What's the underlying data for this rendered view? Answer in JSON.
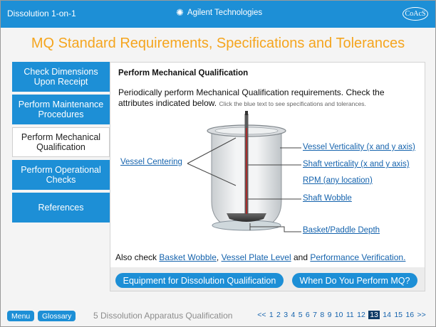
{
  "header": {
    "app_title": "Dissolution 1-on-1",
    "brand_name": "Agilent Technologies",
    "badge_text": "CoAcS"
  },
  "headline": "MQ Standard Requirements, Specifications and Tolerances",
  "nav": {
    "items": [
      {
        "label": "Check Dimensions Upon Receipt"
      },
      {
        "label": "Perform Maintenance Procedures"
      },
      {
        "label": "Perform Mechanical Qualification"
      },
      {
        "label": "Perform Operational Checks"
      },
      {
        "label": "References"
      }
    ],
    "active_index": 2
  },
  "content": {
    "title": "Perform Mechanical Qualification",
    "intro": "Periodically perform Mechanical Qualification requirements. Check the attributes indicated below.",
    "hint": "Click the blue text to see specifications and tolerances.",
    "diagram_links": {
      "vessel_centering": "Vessel Centering",
      "vessel_verticality": "Vessel Verticality (x and y axis)",
      "shaft_verticality": "Shaft verticality (x and y axis)",
      "rpm": "RPM (any location)",
      "shaft_wobble": "Shaft Wobble",
      "basket_paddle_depth": "Basket/Paddle Depth"
    },
    "also_check": {
      "prefix": "Also check",
      "link1": "Basket Wobble",
      "sep1": ",",
      "link2": "Vessel Plate Level",
      "and_word": "and",
      "link3": "Performance Verification."
    },
    "buttons": {
      "equipment": "Equipment for Dissolution Qualification",
      "when": "When Do You Perform MQ?"
    }
  },
  "footer": {
    "menu_label": "Menu",
    "glossary_label": "Glossary",
    "section_label": "5 Dissolution Apparatus Qualification",
    "pager_prev": "<<",
    "pages": [
      "1",
      "2",
      "3",
      "4",
      "5",
      "6",
      "7",
      "8",
      "9",
      "10",
      "11",
      "12",
      "13",
      "14",
      "15",
      "16"
    ],
    "current_page": "13",
    "pager_next": ">>"
  },
  "colors": {
    "accent_blue": "#1d8fd6",
    "headline_orange": "#f5a51e",
    "link_blue": "#1563ad",
    "current_page_bg": "#0e3b66"
  }
}
